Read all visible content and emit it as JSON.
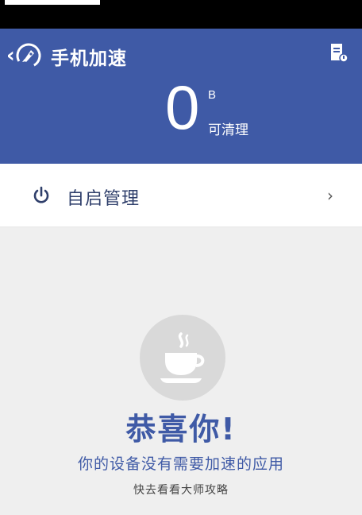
{
  "header": {
    "title": "手机加速",
    "back_icon": "back-chevron-icon",
    "logo_icon": "rocket-speed-icon",
    "menu_icon": "document-icon",
    "accent_color": "#3f5aa6"
  },
  "summary": {
    "value": "0",
    "unit": "B",
    "caption": "可清理"
  },
  "autostart": {
    "label": "自启管理",
    "icon": "power-icon"
  },
  "empty_state": {
    "icon": "coffee-cup-icon",
    "headline": "恭喜你!",
    "message": "你的设备没有需要加速的应用",
    "link": "快去看看大师攻略"
  }
}
